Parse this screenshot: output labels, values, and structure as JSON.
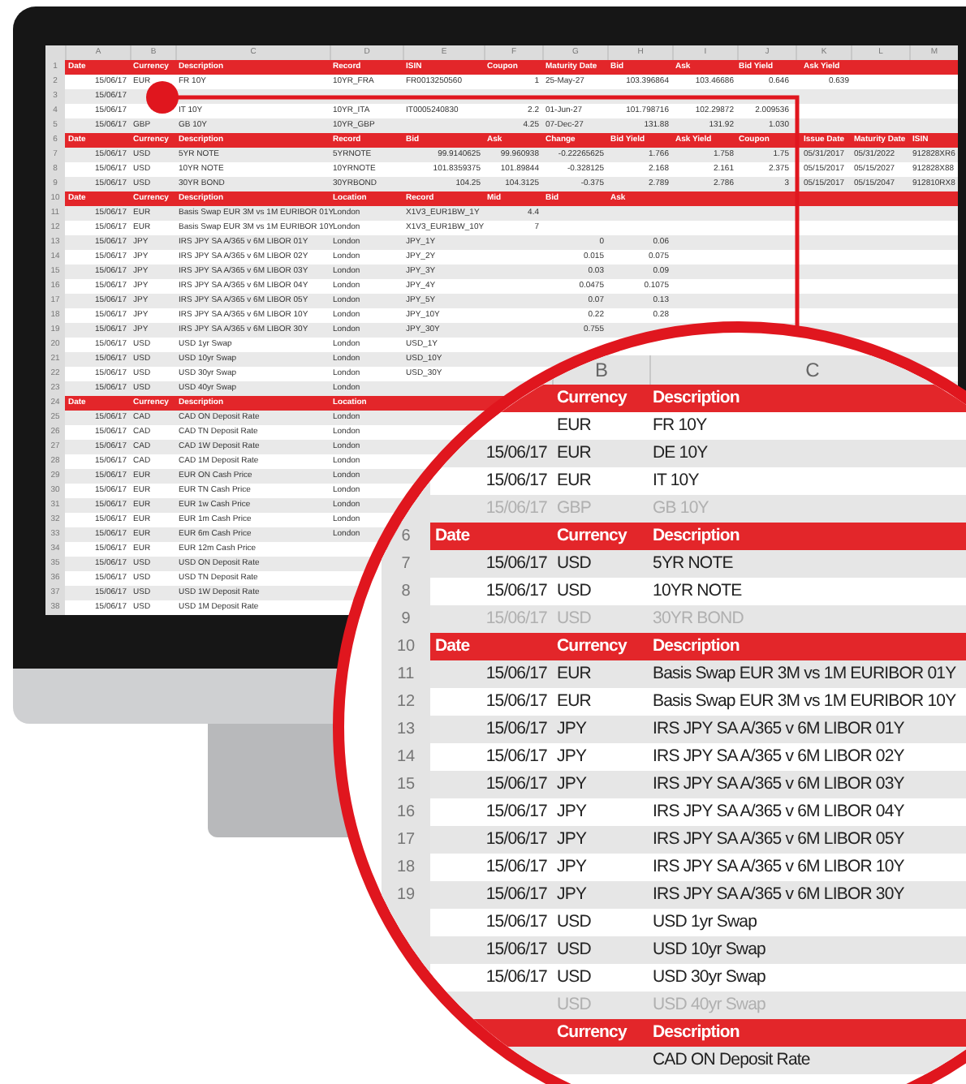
{
  "sheet": {
    "column_letters": [
      "A",
      "B",
      "C",
      "D",
      "E",
      "F",
      "G",
      "H",
      "I",
      "J",
      "K",
      "L",
      "M"
    ],
    "rows": [
      {
        "number": "1",
        "kind": "header",
        "cells": [
          "Date",
          "Currency",
          "Description",
          "Record",
          "ISIN",
          "Coupon",
          "Maturity Date",
          "Bid",
          "Ask",
          "Bid Yield",
          "Ask Yield"
        ]
      },
      {
        "number": "2",
        "kind": "data",
        "cells": [
          "15/06/17",
          "EUR",
          "FR 10Y",
          "10YR_FRA",
          "FR0013250560",
          "1",
          "25-May-27",
          "103.396864",
          "103.46686",
          "0.646",
          "0.639"
        ]
      },
      {
        "number": "3",
        "kind": "data",
        "cells": [
          "15/06/17"
        ]
      },
      {
        "number": "4",
        "kind": "data",
        "cells": [
          "15/06/17",
          null,
          "IT 10Y",
          "10YR_ITA",
          "IT0005240830",
          "2.2",
          "01-Jun-27",
          "101.798716",
          "102.29872",
          "2.009536"
        ]
      },
      {
        "number": "5",
        "kind": "data",
        "cells": [
          "15/06/17",
          "GBP",
          "GB 10Y",
          "10YR_GBP",
          null,
          "4.25",
          "07-Dec-27",
          "131.88",
          "131.92",
          "1.030"
        ]
      },
      {
        "number": "6",
        "kind": "header",
        "cells": [
          "Date",
          "Currency",
          "Description",
          "Record",
          "Bid",
          "Ask",
          "Change",
          "Bid Yield",
          "Ask Yield",
          "Coupon",
          "Issue Date",
          "Maturity Date",
          "ISIN"
        ]
      },
      {
        "number": "7",
        "kind": "data",
        "cells": [
          "15/06/17",
          "USD",
          "5YR NOTE",
          "5YRNOTE",
          "99.9140625",
          "99.960938",
          "-0.22265625",
          "1.766",
          "1.758",
          "1.75",
          "05/31/2017",
          "05/31/2022",
          "912828XR6"
        ]
      },
      {
        "number": "8",
        "kind": "data",
        "cells": [
          "15/06/17",
          "USD",
          "10YR NOTE",
          "10YRNOTE",
          "101.8359375",
          "101.89844",
          "-0.328125",
          "2.168",
          "2.161",
          "2.375",
          "05/15/2017",
          "05/15/2027",
          "912828X88"
        ]
      },
      {
        "number": "9",
        "kind": "data",
        "cells": [
          "15/06/17",
          "USD",
          "30YR BOND",
          "30YRBOND",
          "104.25",
          "104.3125",
          "-0.375",
          "2.789",
          "2.786",
          "3",
          "05/15/2017",
          "05/15/2047",
          "912810RX8"
        ]
      },
      {
        "number": "10",
        "kind": "header",
        "cells": [
          "Date",
          "Currency",
          "Description",
          "Location",
          "Record",
          "Mid",
          "Bid",
          "Ask"
        ]
      },
      {
        "number": "11",
        "kind": "data",
        "cells": [
          "15/06/17",
          "EUR",
          "Basis Swap EUR 3M vs 1M EURIBOR 01Y",
          "London",
          "X1V3_EUR1BW_1Y",
          "4.4"
        ]
      },
      {
        "number": "12",
        "kind": "data",
        "cells": [
          "15/06/17",
          "EUR",
          "Basis Swap EUR 3M vs 1M EURIBOR 10Y",
          "London",
          "X1V3_EUR1BW_10Y",
          "7"
        ]
      },
      {
        "number": "13",
        "kind": "data",
        "cells": [
          "15/06/17",
          "JPY",
          "IRS JPY SA A/365 v 6M LIBOR 01Y",
          "London",
          "JPY_1Y",
          null,
          "0",
          "0.06"
        ]
      },
      {
        "number": "14",
        "kind": "data",
        "cells": [
          "15/06/17",
          "JPY",
          "IRS JPY SA A/365 v 6M LIBOR 02Y",
          "London",
          "JPY_2Y",
          null,
          "0.015",
          "0.075"
        ]
      },
      {
        "number": "15",
        "kind": "data",
        "cells": [
          "15/06/17",
          "JPY",
          "IRS JPY SA A/365 v 6M LIBOR 03Y",
          "London",
          "JPY_3Y",
          null,
          "0.03",
          "0.09"
        ]
      },
      {
        "number": "16",
        "kind": "data",
        "cells": [
          "15/06/17",
          "JPY",
          "IRS JPY SA A/365 v 6M LIBOR 04Y",
          "London",
          "JPY_4Y",
          null,
          "0.0475",
          "0.1075"
        ]
      },
      {
        "number": "17",
        "kind": "data",
        "cells": [
          "15/06/17",
          "JPY",
          "IRS JPY SA A/365 v 6M LIBOR 05Y",
          "London",
          "JPY_5Y",
          null,
          "0.07",
          "0.13"
        ]
      },
      {
        "number": "18",
        "kind": "data",
        "cells": [
          "15/06/17",
          "JPY",
          "IRS JPY SA A/365 v 6M LIBOR 10Y",
          "London",
          "JPY_10Y",
          null,
          "0.22",
          "0.28"
        ]
      },
      {
        "number": "19",
        "kind": "data",
        "cells": [
          "15/06/17",
          "JPY",
          "IRS JPY SA A/365 v 6M LIBOR 30Y",
          "London",
          "JPY_30Y",
          null,
          "0.755"
        ]
      },
      {
        "number": "20",
        "kind": "data",
        "cells": [
          "15/06/17",
          "USD",
          "USD 1yr Swap",
          "London",
          "USD_1Y"
        ]
      },
      {
        "number": "21",
        "kind": "data",
        "cells": [
          "15/06/17",
          "USD",
          "USD 10yr Swap",
          "London",
          "USD_10Y"
        ]
      },
      {
        "number": "22",
        "kind": "data",
        "cells": [
          "15/06/17",
          "USD",
          "USD 30yr Swap",
          "London",
          "USD_30Y"
        ]
      },
      {
        "number": "23",
        "kind": "data",
        "cells": [
          "15/06/17",
          "USD",
          "USD 40yr Swap",
          "London"
        ]
      },
      {
        "number": "24",
        "kind": "header",
        "cells": [
          "Date",
          "Currency",
          "Description",
          "Location"
        ]
      },
      {
        "number": "25",
        "kind": "data",
        "cells": [
          "15/06/17",
          "CAD",
          "CAD ON Deposit Rate",
          "London"
        ]
      },
      {
        "number": "26",
        "kind": "data",
        "cells": [
          "15/06/17",
          "CAD",
          "CAD TN Deposit Rate",
          "London"
        ]
      },
      {
        "number": "27",
        "kind": "data",
        "cells": [
          "15/06/17",
          "CAD",
          "CAD 1W Deposit Rate",
          "London"
        ]
      },
      {
        "number": "28",
        "kind": "data",
        "cells": [
          "15/06/17",
          "CAD",
          "CAD 1M Deposit Rate",
          "London"
        ]
      },
      {
        "number": "29",
        "kind": "data",
        "cells": [
          "15/06/17",
          "EUR",
          "EUR ON Cash Price",
          "London"
        ]
      },
      {
        "number": "30",
        "kind": "data",
        "cells": [
          "15/06/17",
          "EUR",
          "EUR TN Cash Price",
          "London"
        ]
      },
      {
        "number": "31",
        "kind": "data",
        "cells": [
          "15/06/17",
          "EUR",
          "EUR 1w Cash Price",
          "London"
        ]
      },
      {
        "number": "32",
        "kind": "data",
        "cells": [
          "15/06/17",
          "EUR",
          "EUR 1m Cash Price",
          "London"
        ]
      },
      {
        "number": "33",
        "kind": "data",
        "cells": [
          "15/06/17",
          "EUR",
          "EUR 6m Cash Price",
          "London"
        ]
      },
      {
        "number": "34",
        "kind": "data",
        "cells": [
          "15/06/17",
          "EUR",
          "EUR 12m Cash Price"
        ]
      },
      {
        "number": "35",
        "kind": "data",
        "cells": [
          "15/06/17",
          "USD",
          "USD ON Deposit Rate"
        ]
      },
      {
        "number": "36",
        "kind": "data",
        "cells": [
          "15/06/17",
          "USD",
          "USD TN Deposit Rate"
        ]
      },
      {
        "number": "37",
        "kind": "data",
        "cells": [
          "15/06/17",
          "USD",
          "USD 1W Deposit Rate"
        ]
      },
      {
        "number": "38",
        "kind": "data",
        "cells": [
          "15/06/17",
          "USD",
          "USD 1M Deposit Rate"
        ]
      }
    ]
  },
  "magnifier": {
    "column_letters": [
      "B",
      "C"
    ],
    "rows": [
      {
        "kind": "header",
        "currency": "Currency",
        "description": "Description"
      },
      {
        "kind": "data",
        "currency": "EUR",
        "description": "FR 10Y",
        "faded": false
      },
      {
        "kind": "data",
        "date": "15/06/17",
        "currency": "EUR",
        "description": "DE 10Y",
        "faded": false
      },
      {
        "kind": "data",
        "date": "15/06/17",
        "currency": "EUR",
        "description": "IT 10Y",
        "faded": false
      },
      {
        "kind": "data",
        "date": "15/06/17",
        "currency": "GBP",
        "description": "GB 10Y",
        "faded": true
      },
      {
        "number": "6",
        "kind": "header",
        "date": "Date",
        "currency": "Currency",
        "description": "Description"
      },
      {
        "number": "7",
        "kind": "data",
        "date": "15/06/17",
        "currency": "USD",
        "description": "5YR NOTE",
        "faded": false
      },
      {
        "number": "8",
        "kind": "data",
        "date": "15/06/17",
        "currency": "USD",
        "description": "10YR NOTE",
        "faded": false
      },
      {
        "number": "9",
        "kind": "data",
        "date": "15/06/17",
        "currency": "USD",
        "description": "30YR BOND",
        "faded": true
      },
      {
        "number": "10",
        "kind": "header",
        "date": "Date",
        "currency": "Currency",
        "description": "Description"
      },
      {
        "number": "11",
        "kind": "data",
        "date": "15/06/17",
        "currency": "EUR",
        "description": "Basis Swap EUR 3M vs 1M EURIBOR 01Y",
        "faded": false
      },
      {
        "number": "12",
        "kind": "data",
        "date": "15/06/17",
        "currency": "EUR",
        "description": "Basis Swap EUR 3M vs 1M EURIBOR 10Y",
        "faded": false
      },
      {
        "number": "13",
        "kind": "data",
        "date": "15/06/17",
        "currency": "JPY",
        "description": "IRS JPY SA A/365 v 6M LIBOR 01Y",
        "faded": false
      },
      {
        "number": "14",
        "kind": "data",
        "date": "15/06/17",
        "currency": "JPY",
        "description": "IRS JPY SA A/365 v 6M LIBOR 02Y",
        "faded": false
      },
      {
        "number": "15",
        "kind": "data",
        "date": "15/06/17",
        "currency": "JPY",
        "description": "IRS JPY SA A/365 v 6M LIBOR 03Y",
        "faded": false
      },
      {
        "number": "16",
        "kind": "data",
        "date": "15/06/17",
        "currency": "JPY",
        "description": "IRS JPY SA A/365 v 6M LIBOR 04Y",
        "faded": false
      },
      {
        "number": "17",
        "kind": "data",
        "date": "15/06/17",
        "currency": "JPY",
        "description": "IRS JPY SA A/365 v 6M LIBOR 05Y",
        "faded": false
      },
      {
        "number": "18",
        "kind": "data",
        "date": "15/06/17",
        "currency": "JPY",
        "description": "IRS JPY SA A/365 v 6M LIBOR 10Y",
        "faded": false
      },
      {
        "number": "19",
        "kind": "data",
        "date": "15/06/17",
        "currency": "JPY",
        "description": "IRS JPY SA A/365 v 6M LIBOR 30Y",
        "faded": false
      },
      {
        "kind": "data",
        "date": "15/06/17",
        "currency": "USD",
        "description": "USD 1yr Swap",
        "faded": false
      },
      {
        "kind": "data",
        "date": "15/06/17",
        "currency": "USD",
        "description": "USD 10yr Swap",
        "faded": false
      },
      {
        "kind": "data",
        "date": "15/06/17",
        "currency": "USD",
        "description": "USD 30yr Swap",
        "faded": false
      },
      {
        "kind": "data",
        "currency": "USD",
        "description": "USD 40yr Swap",
        "faded": true
      },
      {
        "kind": "header",
        "currency": "Currency",
        "description": "Description"
      },
      {
        "kind": "data",
        "description": "CAD ON Deposit Rate",
        "faded": false
      }
    ]
  }
}
